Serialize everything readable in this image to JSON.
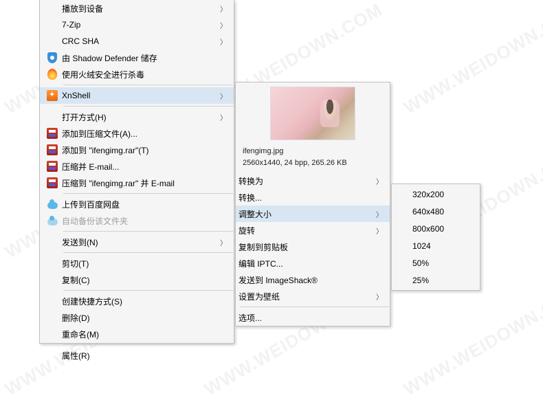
{
  "watermark": "WWW.WEIDOWN.COM",
  "primary": {
    "play_to_device": "播放到设备",
    "seven_zip": "7-Zip",
    "crc_sha": "CRC SHA",
    "shadow_defender": "由 Shadow Defender 储存",
    "huorong_scan": "使用火绒安全进行杀毒",
    "xnshell": "XnShell",
    "open_with": "打开方式(H)",
    "add_to_archive": "添加到压缩文件(A)...",
    "add_to_rar": "添加到 \"ifengimg.rar\"(T)",
    "compress_email": "压缩并 E-mail...",
    "compress_rar_email": "压缩到 \"ifengimg.rar\" 并 E-mail",
    "upload_baidu": "上传到百度网盘",
    "auto_backup": "自动备份该文件夹",
    "send_to": "发送到(N)",
    "cut": "剪切(T)",
    "copy": "复制(C)",
    "create_shortcut": "创建快捷方式(S)",
    "delete": "删除(D)",
    "rename": "重命名(M)",
    "properties": "属性(R)"
  },
  "secondary": {
    "filename": "ifengimg.jpg",
    "meta": "2560x1440, 24 bpp, 265.26 KB",
    "convert_to": "转换为",
    "convert": "转换...",
    "resize": "调整大小",
    "rotate": "旋转",
    "copy_clipboard": "复制到剪贴板",
    "edit_iptc": "编辑 IPTC...",
    "send_imageshack": "发送到 ImageShack®",
    "set_wallpaper": "设置为壁纸",
    "options": "选项..."
  },
  "tertiary": {
    "r320": "320x200",
    "r640": "640x480",
    "r800": "800x600",
    "r1024": "1024",
    "p50": "50%",
    "p25": "25%"
  }
}
